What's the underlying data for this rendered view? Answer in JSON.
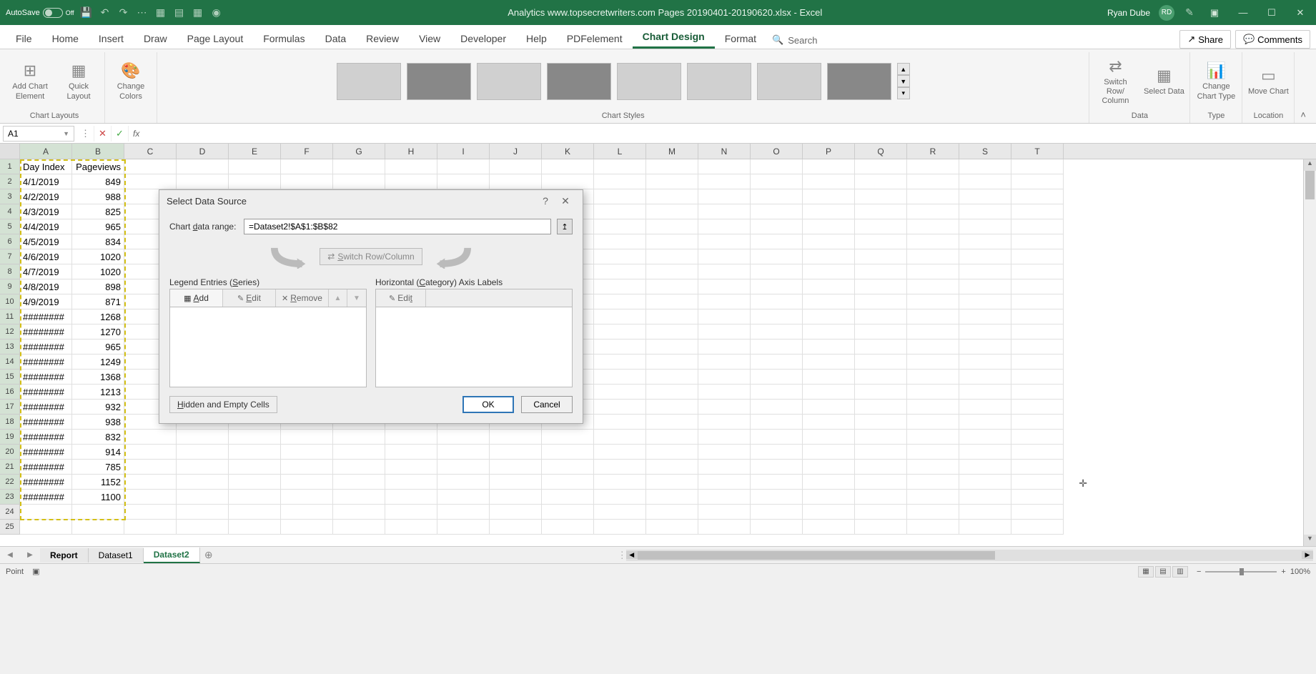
{
  "titlebar": {
    "autosave_label": "AutoSave",
    "autosave_state": "Off",
    "doc_title": "Analytics www.topsecretwriters.com Pages 20190401-20190620.xlsx - Excel",
    "user_name": "Ryan Dube",
    "user_initials": "RD"
  },
  "ribbon_tabs": [
    "File",
    "Home",
    "Insert",
    "Draw",
    "Page Layout",
    "Formulas",
    "Data",
    "Review",
    "View",
    "Developer",
    "Help",
    "PDFelement",
    "Chart Design",
    "Format"
  ],
  "ribbon_active": "Chart Design",
  "search_placeholder": "Search",
  "share_label": "Share",
  "comments_label": "Comments",
  "ribbon_groups": {
    "chart_layouts": {
      "label": "Chart Layouts",
      "add_element": "Add Chart Element",
      "quick_layout": "Quick Layout",
      "change_colors": "Change Colors"
    },
    "chart_styles": {
      "label": "Chart Styles"
    },
    "data": {
      "label": "Data",
      "switch_rc": "Switch Row/ Column",
      "select_data": "Select Data"
    },
    "type": {
      "label": "Type",
      "change_type": "Change Chart Type"
    },
    "location": {
      "label": "Location",
      "move_chart": "Move Chart"
    }
  },
  "name_box": "A1",
  "columns": [
    "A",
    "B",
    "C",
    "D",
    "E",
    "F",
    "G",
    "H",
    "I",
    "J",
    "K",
    "L",
    "M",
    "N",
    "O",
    "P",
    "Q",
    "R",
    "S",
    "T"
  ],
  "headers": {
    "col_a": "Day Index",
    "col_b": "Pageviews"
  },
  "rows": [
    {
      "a": "4/1/2019",
      "b": 849
    },
    {
      "a": "4/2/2019",
      "b": 988
    },
    {
      "a": "4/3/2019",
      "b": 825
    },
    {
      "a": "4/4/2019",
      "b": 965
    },
    {
      "a": "4/5/2019",
      "b": 834
    },
    {
      "a": "4/6/2019",
      "b": 1020
    },
    {
      "a": "4/7/2019",
      "b": 1020
    },
    {
      "a": "4/8/2019",
      "b": 898
    },
    {
      "a": "4/9/2019",
      "b": 871
    },
    {
      "a": "########",
      "b": 1268
    },
    {
      "a": "########",
      "b": 1270
    },
    {
      "a": "########",
      "b": 965
    },
    {
      "a": "########",
      "b": 1249
    },
    {
      "a": "########",
      "b": 1368
    },
    {
      "a": "########",
      "b": 1213
    },
    {
      "a": "########",
      "b": 932
    },
    {
      "a": "########",
      "b": 938
    },
    {
      "a": "########",
      "b": 832
    },
    {
      "a": "########",
      "b": 914
    },
    {
      "a": "########",
      "b": 785
    },
    {
      "a": "########",
      "b": 1152
    },
    {
      "a": "########",
      "b": 1100
    }
  ],
  "sheet_tabs": [
    "Report",
    "Dataset1",
    "Dataset2"
  ],
  "sheet_active": "Dataset2",
  "status": {
    "mode": "Point",
    "zoom": "100%"
  },
  "dialog": {
    "title": "Select Data Source",
    "range_label": "Chart data range:",
    "range_value": "=Dataset2!$A$1:$B$82",
    "switch_label": "Switch Row/Column",
    "legend_heading": "Legend Entries (Series)",
    "axis_heading": "Horizontal (Category) Axis Labels",
    "btn_add": "Add",
    "btn_edit": "Edit",
    "btn_remove": "Remove",
    "hidden_cells": "Hidden and Empty Cells",
    "ok": "OK",
    "cancel": "Cancel"
  }
}
